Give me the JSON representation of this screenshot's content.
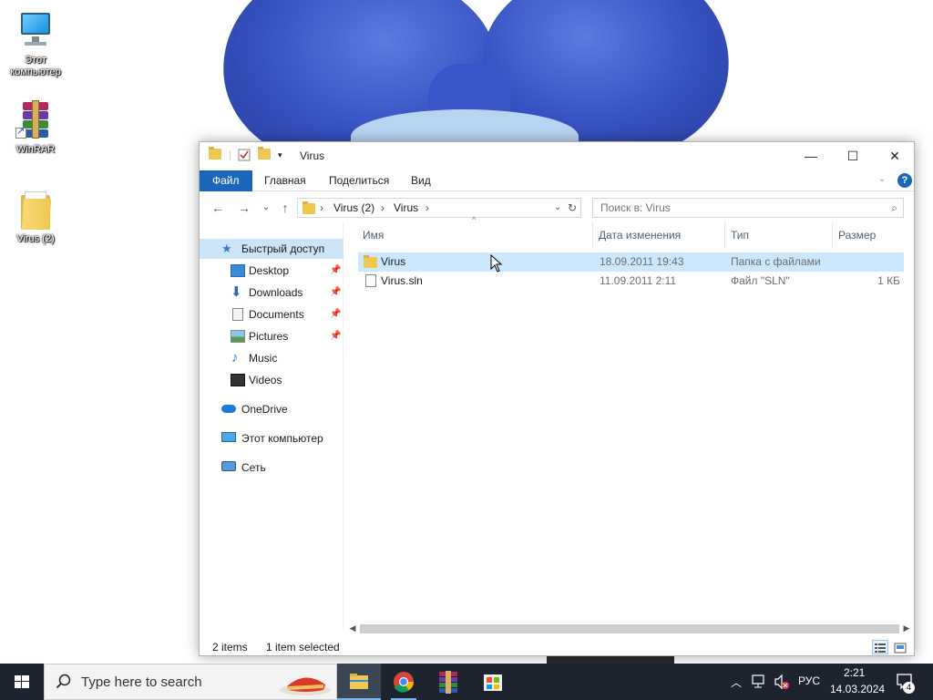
{
  "desktop": {
    "icons": [
      {
        "label": "Этот компьютер",
        "icon": "computer-icon"
      },
      {
        "label": "WinRAR",
        "icon": "winrar-icon"
      },
      {
        "label": "Virus (2)",
        "icon": "folder-icon"
      }
    ]
  },
  "window": {
    "title": "Virus",
    "controls": {
      "minimize": "—",
      "maximize": "☐",
      "close": "✕"
    },
    "ribbon_tabs": [
      "Файл",
      "Главная",
      "Поделиться",
      "Вид"
    ],
    "address": {
      "crumbs": [
        "Virus (2)",
        "Virus"
      ]
    },
    "search_placeholder": "Поиск в: Virus",
    "nav": {
      "quick_access": "Быстрый доступ",
      "pinned": [
        "Desktop",
        "Downloads",
        "Documents",
        "Pictures"
      ],
      "unpinned": [
        "Music",
        "Videos"
      ],
      "onedrive": "OneDrive",
      "this_pc": "Этот компьютер",
      "network": "Сеть"
    },
    "columns": [
      "Имя",
      "Дата изменения",
      "Тип",
      "Размер"
    ],
    "files": [
      {
        "name": "Virus",
        "date": "18.09.2011 19:43",
        "type": "Папка с файлами",
        "size": ""
      },
      {
        "name": "Virus.sln",
        "date": "11.09.2011 2:11",
        "type": "Файл \"SLN\"",
        "size": "1 КБ"
      }
    ],
    "status": {
      "items": "2 items",
      "selected": "1 item selected"
    }
  },
  "taskbar": {
    "search_placeholder": "Type here to search",
    "apps": [
      "file-explorer",
      "chrome",
      "winrar",
      "store"
    ],
    "tray": {
      "language": "РУС",
      "time": "2:21",
      "date": "14.03.2024",
      "notifications": "4"
    }
  },
  "colors": {
    "accent": "#1a67b9",
    "selection": "#cce8ff",
    "taskbar": "#1d2430"
  }
}
